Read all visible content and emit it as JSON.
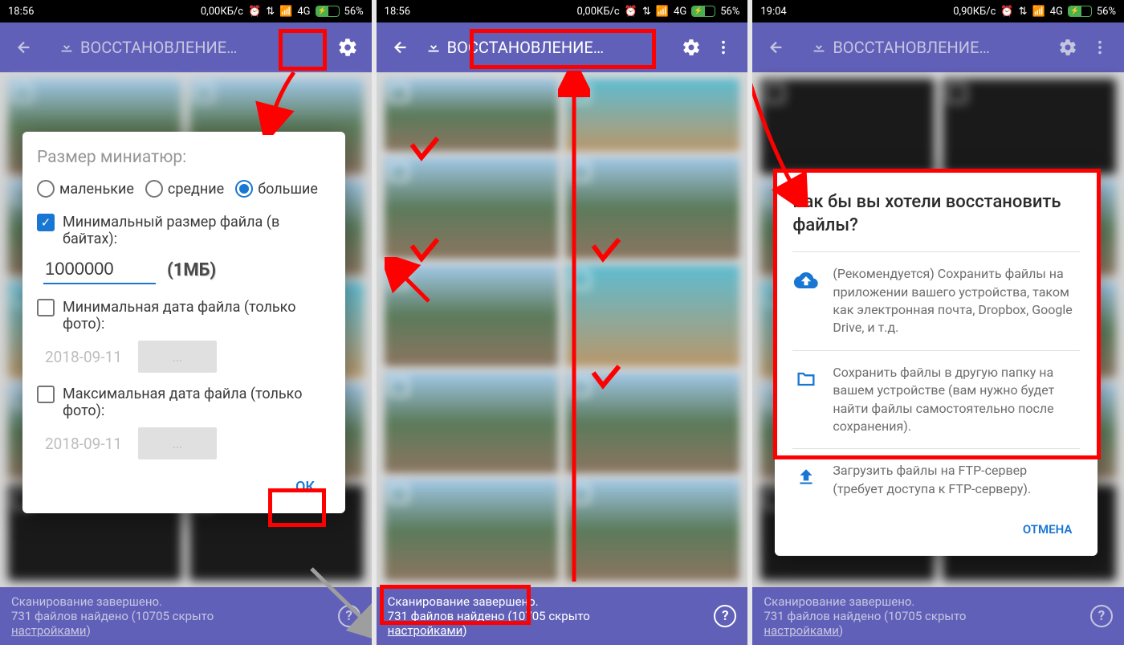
{
  "screens": {
    "left": {
      "time": "18:56",
      "speed": "0,00КБ/с",
      "net": "4G",
      "battery": "56%"
    },
    "center": {
      "time": "18:56",
      "speed": "0,00КБ/с",
      "net": "4G",
      "battery": "56%"
    },
    "right": {
      "time": "19:04",
      "speed": "0,90КБ/с",
      "net": "4G",
      "battery": "56%"
    }
  },
  "app_title": "ВОССТАНОВЛЕНИЕ…",
  "footer": {
    "line1": "Сканирование завершено.",
    "line2_a": "731 файлов найдено",
    "line2_b": " (10705 скрыто",
    "settings_link": "настройками",
    "line2_c": ")"
  },
  "dialog1": {
    "title": "Размер миниатюр:",
    "radio_small": "маленькие",
    "radio_medium": "средние",
    "radio_large": "большие",
    "check_minsize": "Минимальный размер файла (в байтах):",
    "size_value": "1000000",
    "mb_annotation": "(1МБ)",
    "check_mindate": "Минимальная дата файла (только фото):",
    "check_maxdate": "Максимальная дата файла (только фото):",
    "date_value": "2018-09-11",
    "date_btn": "...",
    "ok": "ОК"
  },
  "dialog3": {
    "title": "Как бы вы хотели восстановить файлы?",
    "opt1": "(Рекомендуется) Сохранить файлы на приложении вашего устройства, таком как электронная почта, Dropbox, Google Drive, и т.д.",
    "opt2": "Сохранить файлы в другую папку на вашем устройстве (вам нужно будет найти файлы самостоятельно после сохранения).",
    "opt3": "Загрузить файлы на FTP-сервер (требует доступа к FTP-серверу).",
    "cancel": "ОТМЕНА"
  },
  "help": "?"
}
